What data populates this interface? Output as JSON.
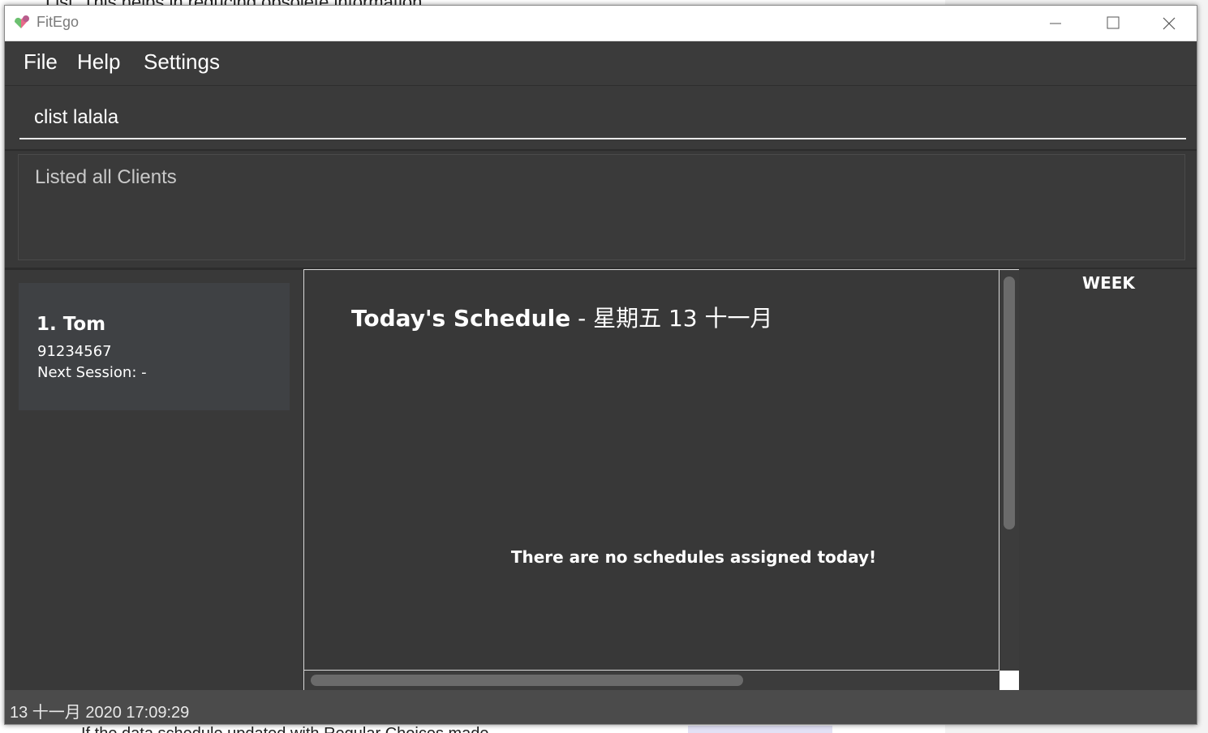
{
  "window": {
    "title": "FitEgo",
    "accent_color": "#383838"
  },
  "menu": {
    "items": [
      {
        "label": "File"
      },
      {
        "label": "Help"
      },
      {
        "label": "Settings"
      }
    ]
  },
  "command": {
    "value": "clist lalala"
  },
  "result": {
    "message": "Listed all Clients"
  },
  "clients": [
    {
      "index_name": "1.  Tom",
      "phone": "91234567",
      "next_session": "Next Session:  -"
    }
  ],
  "schedule": {
    "title_main": "Today's Schedule",
    "title_date": " - 星期五 13 十一月",
    "empty_message": "There are no schedules assigned today!"
  },
  "side": {
    "week_label": "WEEK"
  },
  "status": {
    "datetime": "13 十一月 2020 17:09:29"
  },
  "background_doc": {
    "top_line": "List. This helps in reducing obsolete information.",
    "bottom_line": "If the                                           data schedule      updated with Regular    Choices made"
  }
}
